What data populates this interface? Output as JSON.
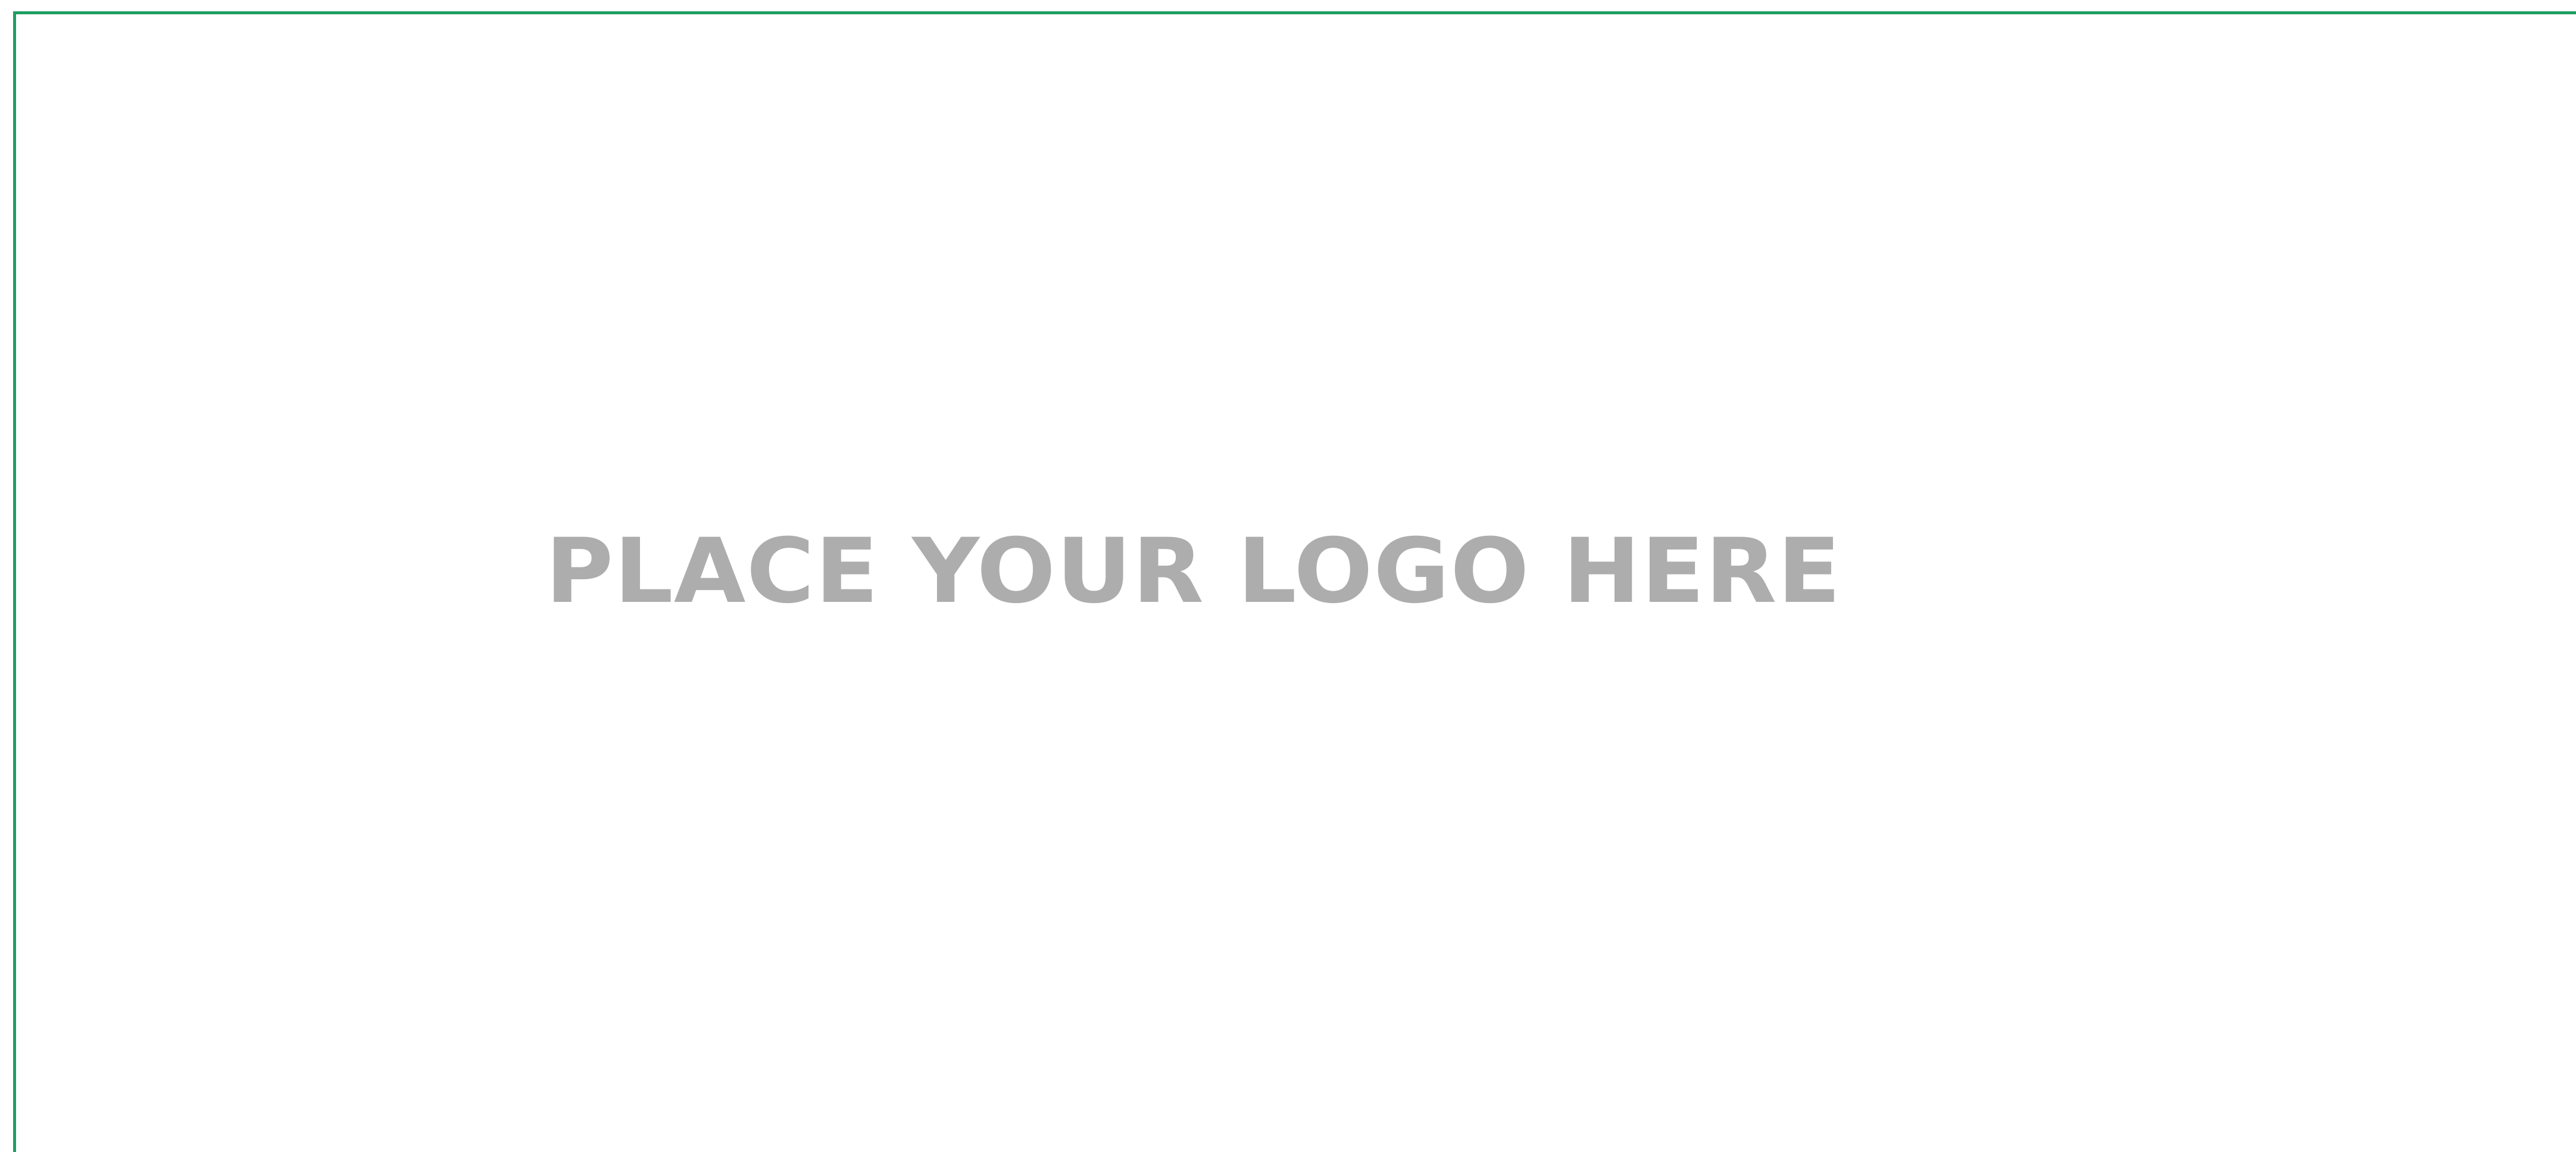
{
  "logo": {
    "text": "PLACE YOUR LOGO HERE",
    "color": "#adadad"
  },
  "frame": {
    "color": "#1e9e63"
  },
  "background_color": "#ffffff"
}
